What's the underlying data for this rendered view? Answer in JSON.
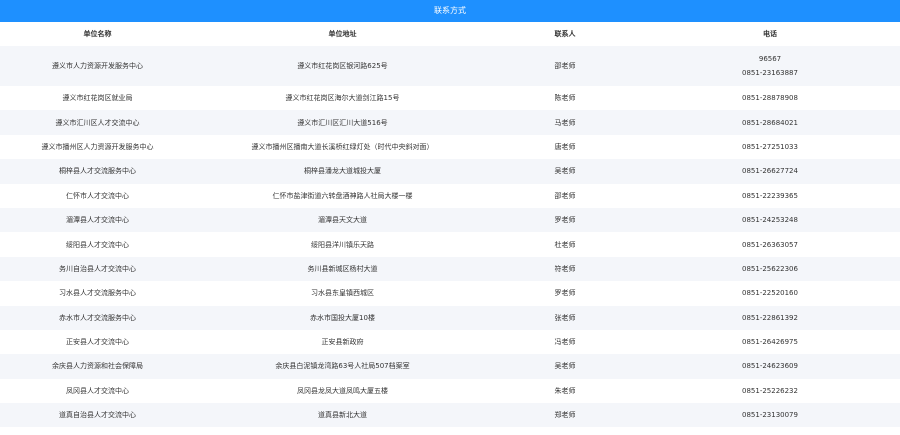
{
  "header": {
    "title": "联系方式"
  },
  "table": {
    "columns": [
      "单位名称",
      "单位地址",
      "联系人",
      "电话"
    ],
    "rows": [
      {
        "name": "遵义市人力资源开发服务中心",
        "address": "遵义市红花岗区银河路625号",
        "contact": "邵老师",
        "phones": [
          "96567",
          "0851-23163887"
        ]
      },
      {
        "name": "遵义市红花岗区就业局",
        "address": "遵义市红花岗区海尔大道剑江路15号",
        "contact": "陈老师",
        "phones": [
          "0851-28878908"
        ]
      },
      {
        "name": "遵义市汇川区人才交流中心",
        "address": "遵义市汇川区汇川大道516号",
        "contact": "马老师",
        "phones": [
          "0851-28684021"
        ]
      },
      {
        "name": "遵义市播州区人力资源开发服务中心",
        "address": "遵义市播州区播南大道长溪桥红绿灯处（时代中央斜对面）",
        "contact": "唐老师",
        "phones": [
          "0851-27251033"
        ]
      },
      {
        "name": "桐梓县人才交流服务中心",
        "address": "桐梓县潘龙大道城投大厦",
        "contact": "吴老师",
        "phones": [
          "0851-26627724"
        ]
      },
      {
        "name": "仁怀市人才交流中心",
        "address": "仁怀市盐津街道六转盘酒神路人社局大楼一楼",
        "contact": "邵老师",
        "phones": [
          "0851-22239365"
        ]
      },
      {
        "name": "湄潭县人才交流中心",
        "address": "湄潭县天文大道",
        "contact": "罗老师",
        "phones": [
          "0851-24253248"
        ]
      },
      {
        "name": "绥阳县人才交流中心",
        "address": "绥阳县洋川镇乐天路",
        "contact": "杜老师",
        "phones": [
          "0851-26363057"
        ]
      },
      {
        "name": "务川自治县人才交流中心",
        "address": "务川县新城区杨村大道",
        "contact": "符老师",
        "phones": [
          "0851-25622306"
        ]
      },
      {
        "name": "习水县人才交流服务中心",
        "address": "习水县东皇镇西城区",
        "contact": "罗老师",
        "phones": [
          "0851-22520160"
        ]
      },
      {
        "name": "赤水市人才交流服务中心",
        "address": "赤水市国投大厦10楼",
        "contact": "张老师",
        "phones": [
          "0851-22861392"
        ]
      },
      {
        "name": "正安县人才交流中心",
        "address": "正安县新政府",
        "contact": "冯老师",
        "phones": [
          "0851-26426975"
        ]
      },
      {
        "name": "余庆县人力资源和社会保障局",
        "address": "余庆县白泥镇龙湾路63号人社局507档案室",
        "contact": "吴老师",
        "phones": [
          "0851-24623609"
        ]
      },
      {
        "name": "凤冈县人才交流中心",
        "address": "凤冈县龙凤大道凤鸣大厦五楼",
        "contact": "朱老师",
        "phones": [
          "0851-25226232"
        ]
      },
      {
        "name": "道真自治县人才交流中心",
        "address": "道真县新北大道",
        "contact": "郑老师",
        "phones": [
          "0851-23130079"
        ]
      }
    ]
  }
}
